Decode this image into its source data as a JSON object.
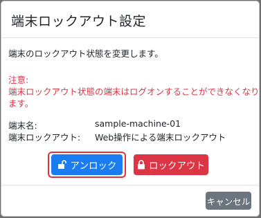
{
  "dialog": {
    "title": "端末ロックアウト設定",
    "description": "端末のロックアウト状態を変更します。",
    "warning_title": "注意:",
    "warning_line1": "端末ロックアウト状態の端末はログオンすることができなくなり",
    "warning_line2": "ます。",
    "fields": {
      "machine_label": "端末名:",
      "machine_value": "sample-machine-01",
      "lockout_label": "端末ロックアウト:",
      "lockout_value": "Web操作による端末ロックアウト"
    },
    "buttons": {
      "unlock_label": "アンロック",
      "lock_label": "ロックアウト",
      "cancel_label": "キャンセル"
    }
  },
  "icons": {
    "unlock": "unlock-icon",
    "lock": "lock-icon"
  },
  "colors": {
    "primary": "#1a7cf0",
    "danger": "#dc3545",
    "secondary": "#6c757d",
    "highlight": "#e0303a"
  }
}
